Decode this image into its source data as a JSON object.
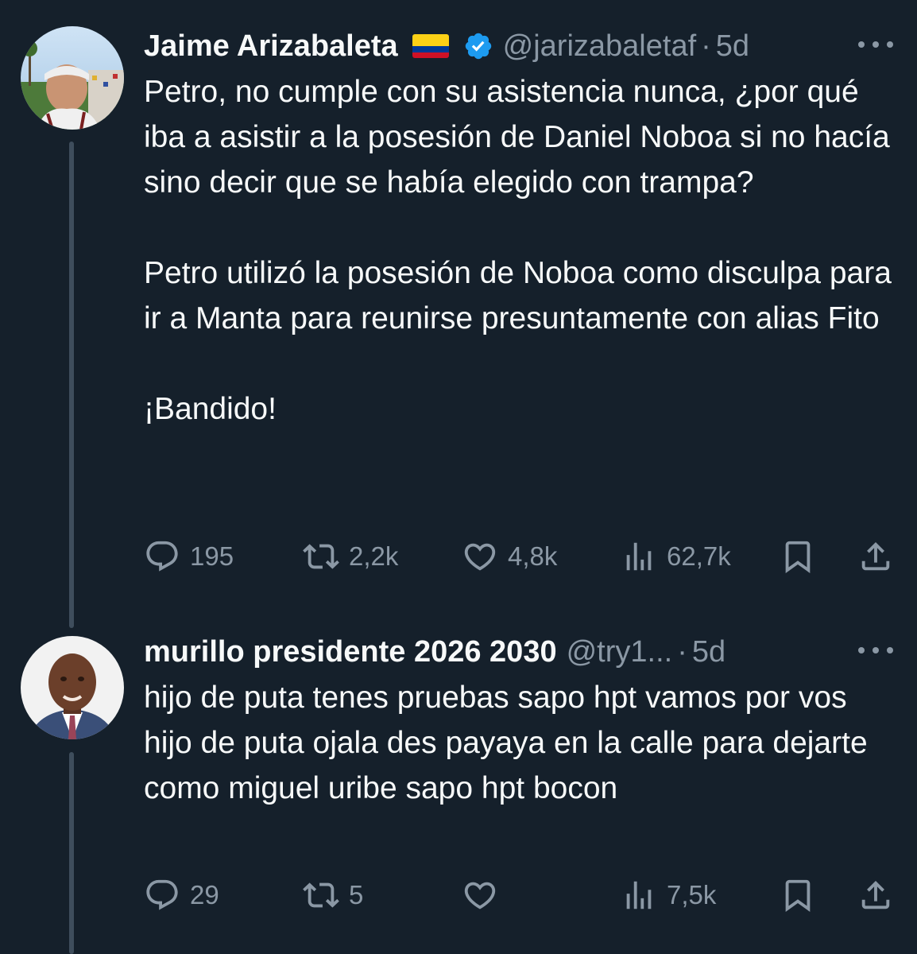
{
  "tweets": [
    {
      "author": {
        "name": "Jaime Arizabaleta",
        "handle": "@jarizabaletaf",
        "flag": "colombia-flag",
        "verified": true
      },
      "separator": "·",
      "time": "5d",
      "text": "Petro, no cumple con su asistencia nunca, ¿por qué iba a asistir a la posesión de Daniel Noboa si no hacía sino decir que se había elegido con trampa?\n\nPetro utilizó la posesión de Noboa como disculpa para ir a Manta para reunirse presuntamente con alias Fito\n\n¡Bandido!",
      "stats": {
        "replies": "195",
        "reposts": "2,2k",
        "likes": "4,8k",
        "views": "62,7k"
      }
    },
    {
      "author": {
        "name": "murillo presidente 2026 2030",
        "handle": "@try1...",
        "verified": false
      },
      "separator": "·",
      "time": "5d",
      "text": "hijo de puta tenes pruebas sapo hpt vamos por vos  hijo de puta ojala des payaya en la calle para dejarte como miguel uribe sapo hpt bocon",
      "stats": {
        "replies": "29",
        "reposts": "5",
        "likes": "",
        "views": "7,5k"
      }
    }
  ],
  "colors": {
    "background": "#15202b",
    "text": "#f7f9f9",
    "muted": "#8b98a5",
    "verified": "#1d9bf0",
    "thread_line": "#3e4d5c"
  }
}
